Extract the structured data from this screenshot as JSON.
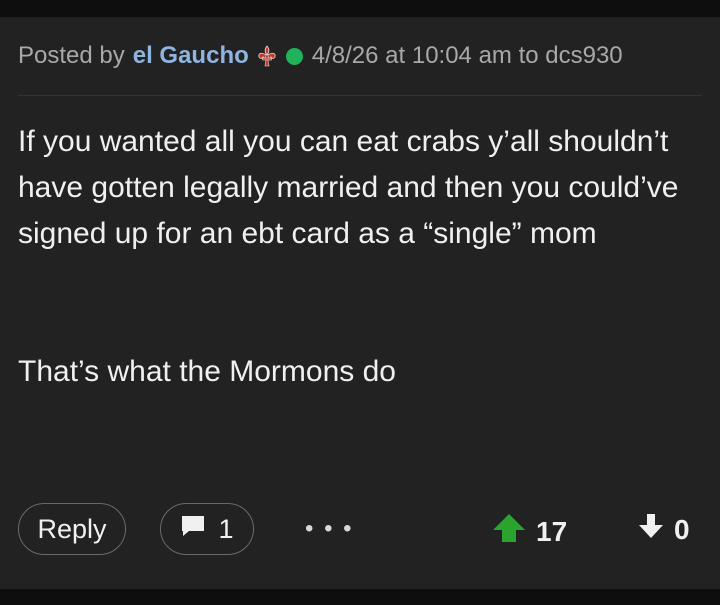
{
  "post": {
    "posted_by_label": "Posted by",
    "author": "el Gaucho",
    "meta": "4/8/26 at 10:04 am to dcs930",
    "body_paragraphs": [
      "If you wanted all you can eat crabs y’all shouldn’t have gotten legally married and then you could’ve signed up for an ebt card as a “single” mom",
      "That’s what the Mormons do"
    ]
  },
  "actions": {
    "reply_label": "Reply",
    "comment_count": "1",
    "more_label": "• • •",
    "upvotes": "17",
    "downvotes": "0"
  },
  "colors": {
    "author": "#8fb4df",
    "online": "#1fb35a",
    "upvote": "#2aa32f",
    "fleur": "#c0392b"
  },
  "icons": {
    "badge": "fleur-de-lis-icon",
    "status": "online-dot-icon",
    "comment": "comment-bubble-icon",
    "upvote": "up-arrow-icon",
    "downvote": "down-arrow-icon"
  }
}
